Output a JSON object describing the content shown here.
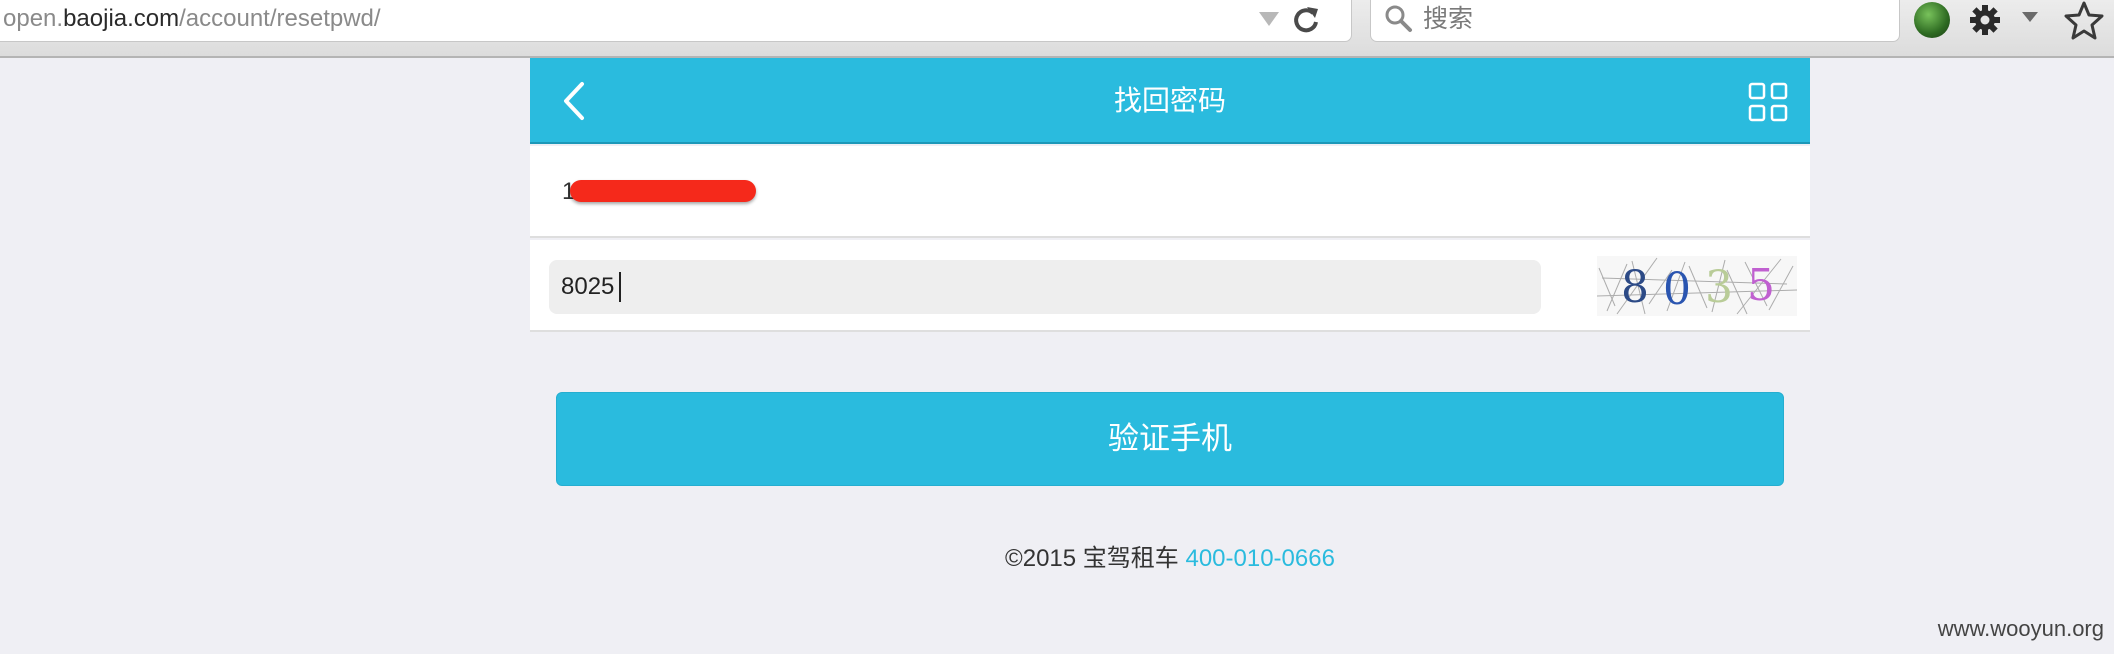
{
  "browser": {
    "url_host": "open.",
    "url_domain": "baojia.com",
    "url_path": "/account/resetpwd/",
    "search_placeholder": "搜索"
  },
  "header": {
    "title": "找回密码",
    "background": "#2abbde"
  },
  "form": {
    "phone_prefix": "1",
    "captcha_value": "8025",
    "captcha_image_text": [
      "8",
      "0",
      "3",
      "5"
    ]
  },
  "button": {
    "label": "验证手机"
  },
  "footer": {
    "copyright": "©2015 宝驾租车 ",
    "phone": "400-010-0666"
  },
  "watermark": "www.wooyun.org",
  "icons": [
    "reload-icon",
    "search-icon",
    "gear-icon",
    "star-icon",
    "back-icon",
    "menu-grid-icon"
  ]
}
